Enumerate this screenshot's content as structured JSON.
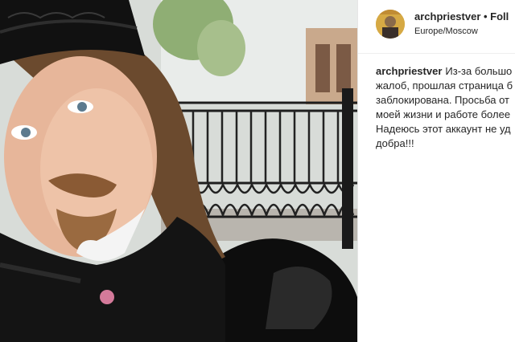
{
  "post": {
    "username": "archpriestver",
    "separator": " • ",
    "follow_label": "Foll",
    "location": "Europe/Moscow",
    "caption_author": "archpriestver",
    "caption_lines": [
      "Из-за большо",
      "жалоб, прошлая страница б",
      "заблокирована. Просьба от",
      "моей жизни и работе более",
      "Надеюсь этот аккаунт не уд",
      "добра!!!"
    ]
  },
  "icons": {
    "avatar": "profile-photo"
  }
}
